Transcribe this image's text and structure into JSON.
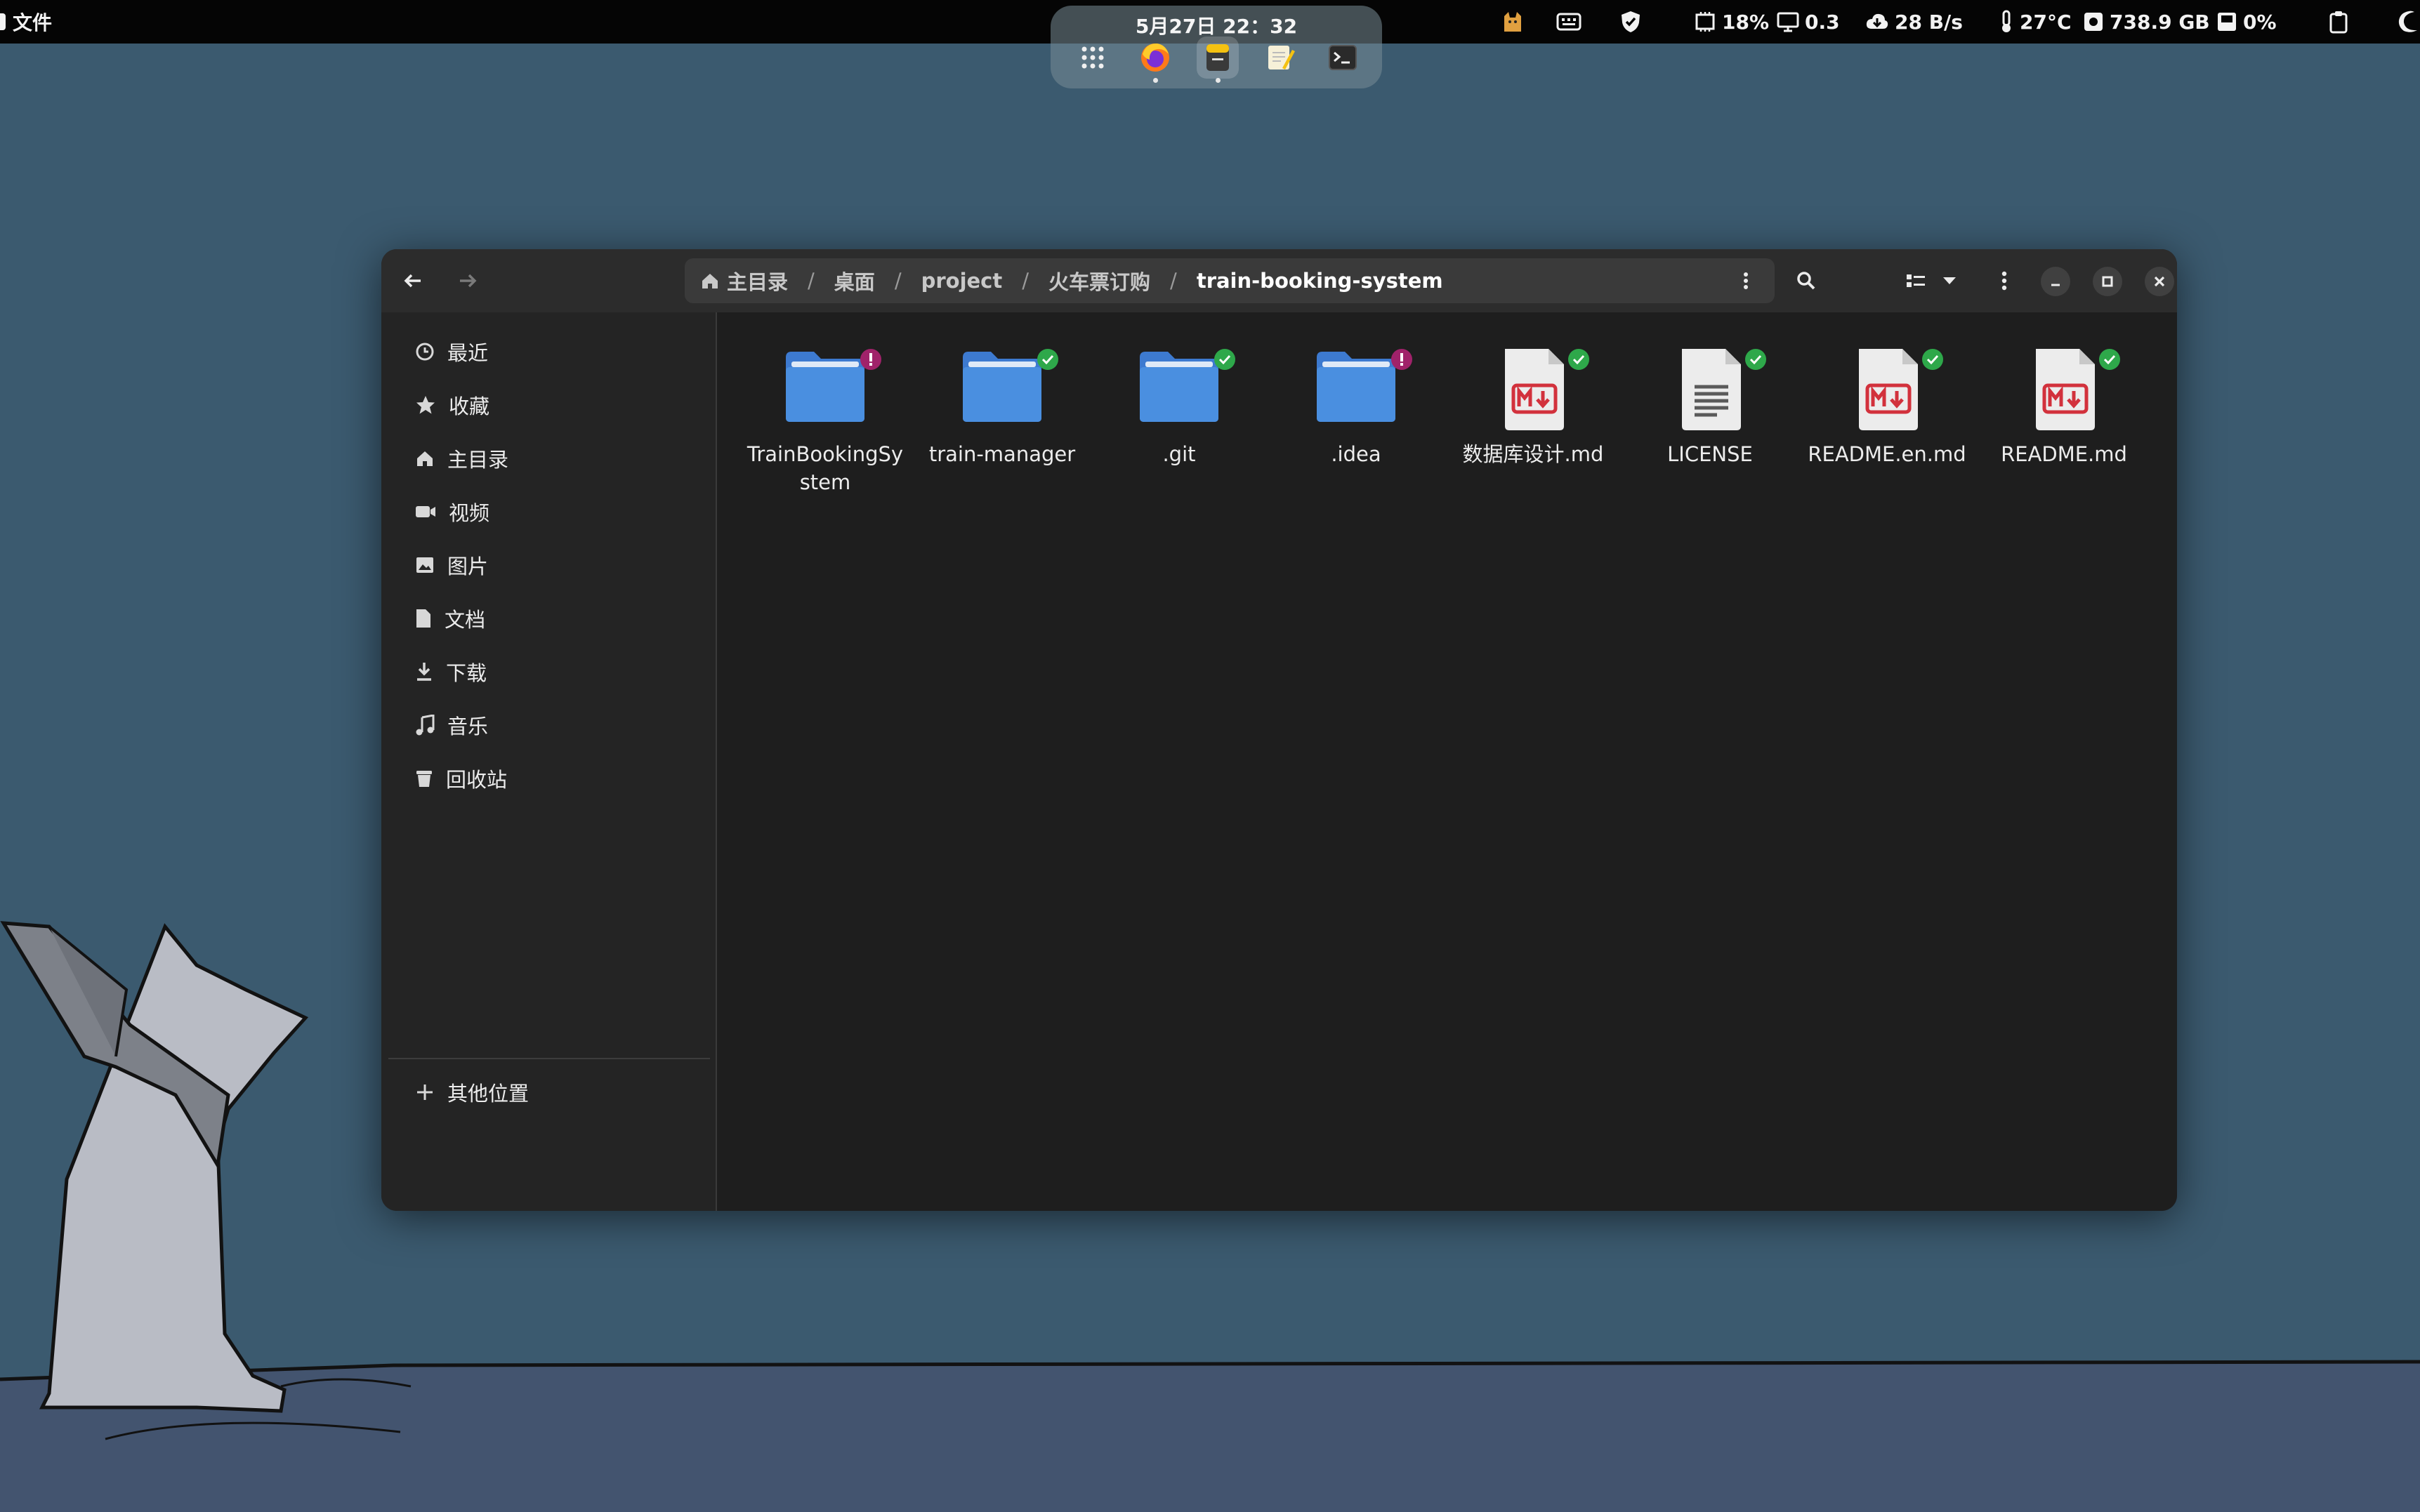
{
  "topbar": {
    "app_menu_label": "文件",
    "clock": "5月27日  22：32",
    "cpu": "18%",
    "load": "0.3",
    "net": "28 B/s",
    "temp": "27°C",
    "disk": "738.9 GB",
    "disk_io": "0%",
    "icons": [
      "cat-tray-icon",
      "keyboard-icon",
      "shield-icon",
      "cpu-icon",
      "monitor-icon",
      "cloud-download-icon",
      "thermometer-icon",
      "disk-icon",
      "disk-io-icon",
      "clipboard-icon",
      "night-mode-icon"
    ]
  },
  "dock": {
    "items": [
      "app-grid-icon",
      "firefox-icon",
      "files-icon",
      "text-editor-icon",
      "terminal-icon"
    ]
  },
  "window": {
    "path": [
      {
        "label": "主目录",
        "icon": "home-icon"
      },
      {
        "label": "桌面"
      },
      {
        "label": "project"
      },
      {
        "label": "火车票订购"
      },
      {
        "label": "train-booking-system"
      }
    ],
    "sidebar": {
      "items": [
        {
          "label": "最近",
          "icon": "clock-icon"
        },
        {
          "label": "收藏",
          "icon": "star-icon"
        },
        {
          "label": "主目录",
          "icon": "home-icon"
        },
        {
          "label": "视频",
          "icon": "video-icon"
        },
        {
          "label": "图片",
          "icon": "image-icon"
        },
        {
          "label": "文档",
          "icon": "document-icon"
        },
        {
          "label": "下载",
          "icon": "download-icon"
        },
        {
          "label": "音乐",
          "icon": "music-icon"
        },
        {
          "label": "回收站",
          "icon": "trash-icon"
        }
      ],
      "other_locations": {
        "label": "其他位置",
        "icon": "plus-icon"
      }
    },
    "files": [
      {
        "name": "TrainBookingSystem",
        "type": "folder",
        "status": "modified"
      },
      {
        "name": "train-manager",
        "type": "folder",
        "status": "synced"
      },
      {
        "name": ".git",
        "type": "folder",
        "status": "synced"
      },
      {
        "name": ".idea",
        "type": "folder",
        "status": "modified"
      },
      {
        "name": "数据库设计.md",
        "type": "markdown",
        "status": "synced"
      },
      {
        "name": "LICENSE",
        "type": "text",
        "status": "synced"
      },
      {
        "name": "README.en.md",
        "type": "markdown",
        "status": "synced"
      },
      {
        "name": "README.md",
        "type": "markdown",
        "status": "synced"
      }
    ]
  },
  "colors": {
    "folder": "#4a8fe0",
    "synced_badge": "#2ea84a",
    "modified_badge": "#a0226a",
    "markdown_red": "#d2313c"
  }
}
